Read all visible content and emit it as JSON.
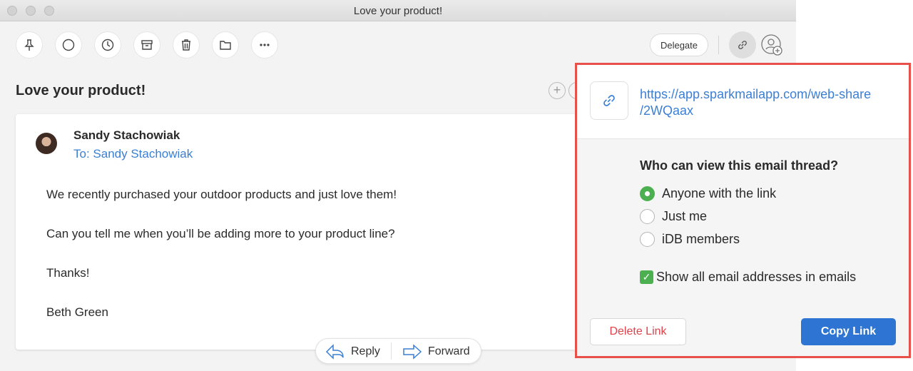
{
  "window": {
    "title": "Love your product!"
  },
  "toolbar": {
    "icons": [
      "pin-icon",
      "circle-icon",
      "clock-icon",
      "archive-icon",
      "trash-icon",
      "folder-icon",
      "more-icon"
    ],
    "delegate_label": "Delegate"
  },
  "email": {
    "subject": "Love your product!",
    "sender": "Sandy Stachowiak",
    "to": "To: Sandy Stachowiak",
    "body": [
      "We recently purchased your outdoor products and just love them!",
      "Can you tell me when you’ll be adding more to your product line?",
      "Thanks!",
      "Beth Green"
    ]
  },
  "actions": {
    "reply_label": "Reply",
    "forward_label": "Forward"
  },
  "share": {
    "url_line1": "https://app.sparkmailapp.com/web-share",
    "url_line2": "/2WQaax",
    "question": "Who can view this email thread?",
    "options": [
      {
        "label": "Anyone with the link",
        "selected": true
      },
      {
        "label": "Just me",
        "selected": false
      },
      {
        "label": "iDB members",
        "selected": false
      }
    ],
    "show_addresses_label": "Show all email addresses in emails",
    "show_addresses_checked": true,
    "delete_label": "Delete Link",
    "copy_label": "Copy Link"
  },
  "colors": {
    "accent": "#2d74d3",
    "link": "#3b7fd4",
    "danger": "#e0414a",
    "selected": "#4caf50",
    "highlight": "#e8504a"
  }
}
